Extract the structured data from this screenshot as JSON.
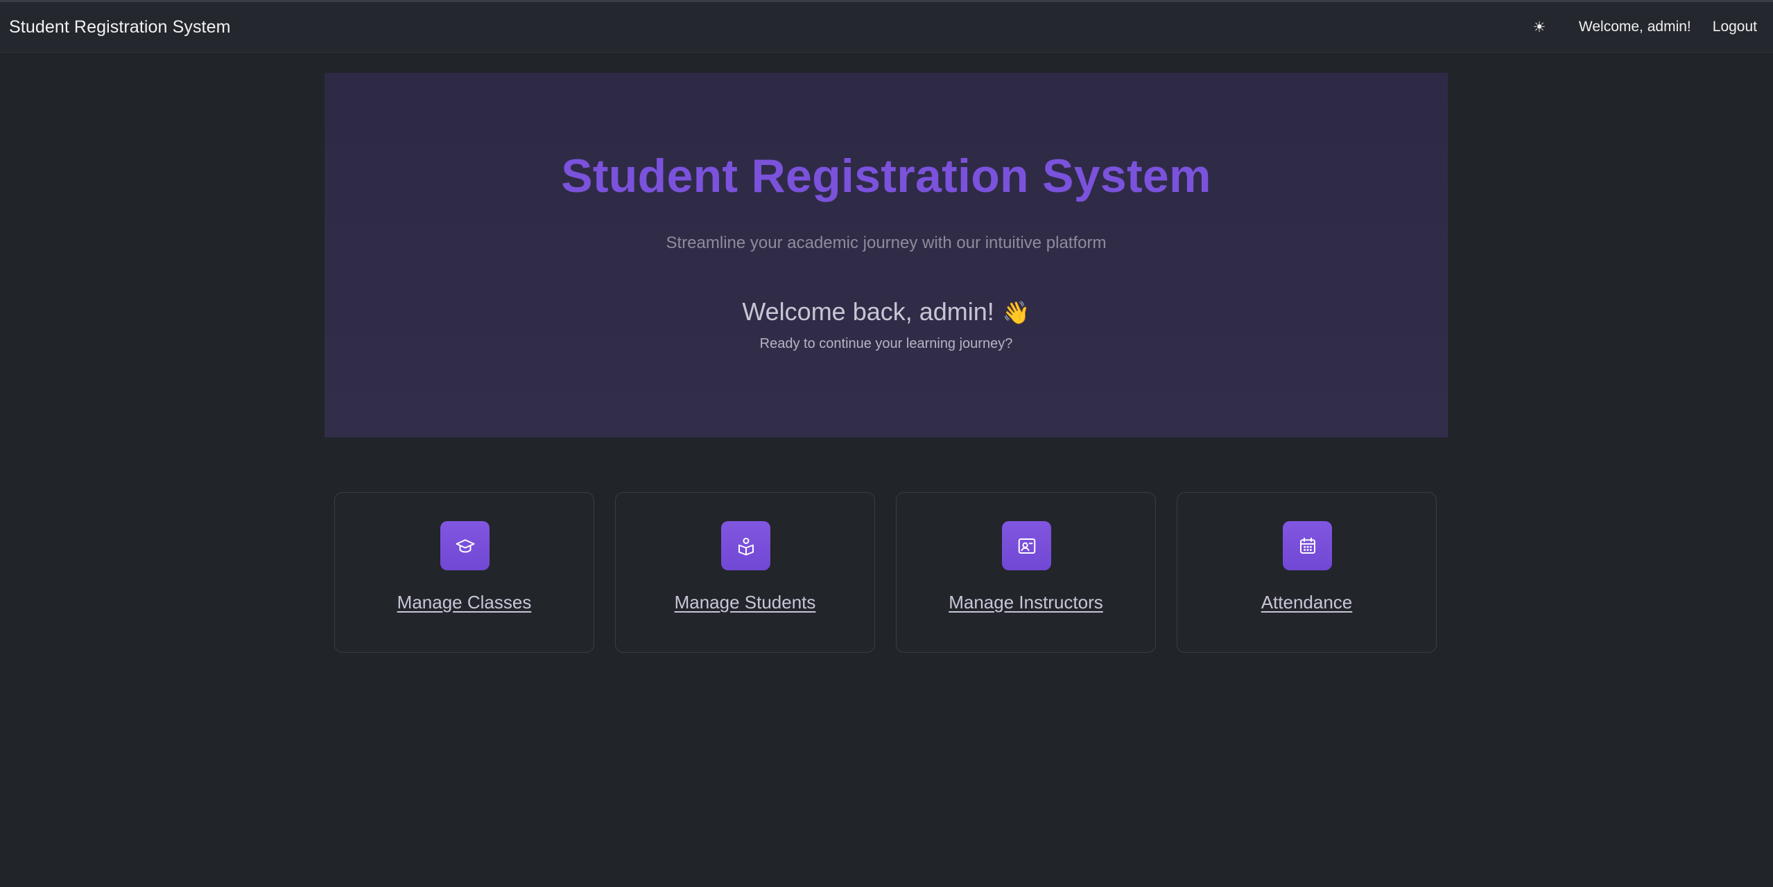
{
  "navbar": {
    "brand": "Student Registration System",
    "theme_toggle_icon": "☀",
    "welcome": "Welcome, admin!",
    "logout": "Logout"
  },
  "hero": {
    "title": "Student Registration System",
    "subtitle": "Streamline your academic journey with our intuitive platform",
    "welcome": "Welcome back, admin!",
    "wave_emoji": "👋",
    "ready": "Ready to continue your learning journey?"
  },
  "cards": [
    {
      "label": "Manage Classes",
      "icon": "graduation-cap-icon"
    },
    {
      "label": "Manage Students",
      "icon": "student-reading-icon"
    },
    {
      "label": "Manage Instructors",
      "icon": "id-card-icon"
    },
    {
      "label": "Attendance",
      "icon": "calendar-icon"
    }
  ],
  "colors": {
    "background": "#212429",
    "navbar": "#24272d",
    "hero": "#302c48",
    "accent": "#7b52dc",
    "card_border": "#3a3d45"
  }
}
